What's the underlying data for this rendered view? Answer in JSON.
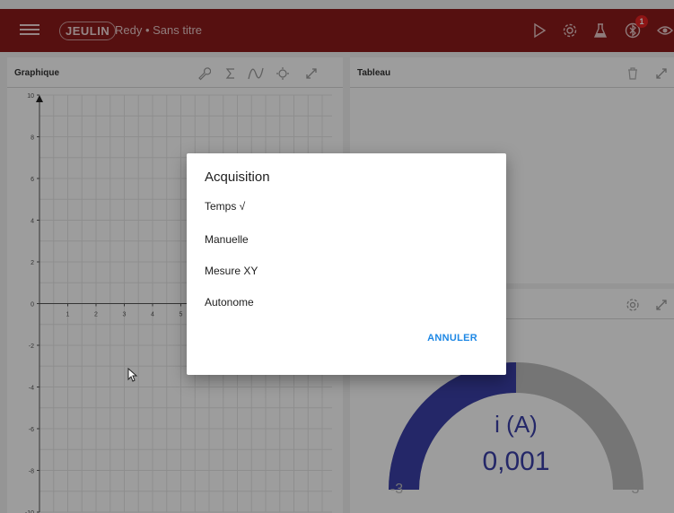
{
  "appbar": {
    "logo_text": "JEULIN",
    "title": "Redy • Sans titre",
    "notification_count": "1"
  },
  "graph_panel": {
    "title": "Graphique",
    "y_ticks": [
      "10",
      "8",
      "6",
      "4",
      "2",
      "0",
      "-2",
      "-4",
      "-6",
      "-8",
      "-10"
    ],
    "x_ticks": [
      "1",
      "2",
      "3",
      "4",
      "5"
    ]
  },
  "table_panel": {
    "title": "Tableau"
  },
  "gauge_panel": {
    "variable": "i (A)",
    "value": "0,001",
    "min": "-3",
    "max": "3",
    "value_fraction": 0.5,
    "fill_color": "#3a40a8",
    "track_color": "#bdbdbd"
  },
  "dialog": {
    "title": "Acquisition",
    "options": [
      "Temps √",
      "Manuelle",
      "Mesure XY",
      "Autonome"
    ],
    "cancel_label": "ANNULER"
  }
}
